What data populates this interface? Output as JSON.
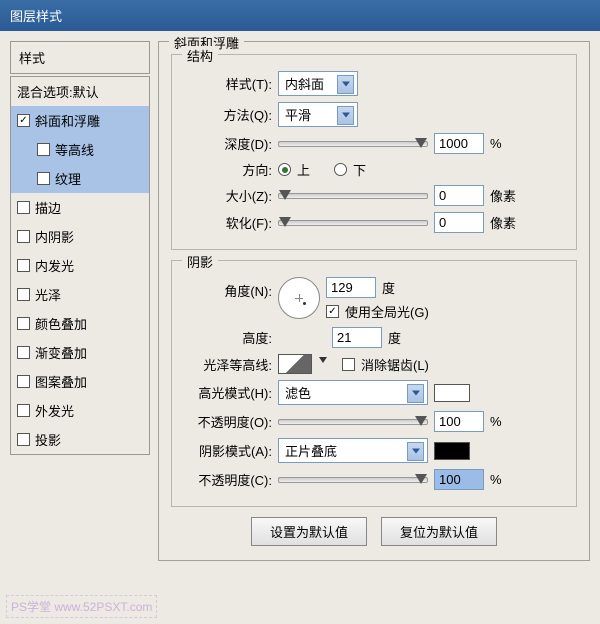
{
  "title": "图层样式",
  "sidebar": {
    "header": "样式",
    "blend": "混合选项:默认",
    "items": [
      {
        "label": "斜面和浮雕",
        "checked": true,
        "selected": true
      },
      {
        "label": "等高线",
        "checked": false,
        "selected": true,
        "indent": true
      },
      {
        "label": "纹理",
        "checked": false,
        "selected": true,
        "indent": true
      },
      {
        "label": "描边",
        "checked": false
      },
      {
        "label": "内阴影",
        "checked": false
      },
      {
        "label": "内发光",
        "checked": false
      },
      {
        "label": "光泽",
        "checked": false
      },
      {
        "label": "颜色叠加",
        "checked": false
      },
      {
        "label": "渐变叠加",
        "checked": false
      },
      {
        "label": "图案叠加",
        "checked": false
      },
      {
        "label": "外发光",
        "checked": false
      },
      {
        "label": "投影",
        "checked": false
      }
    ]
  },
  "main": {
    "legend": "斜面和浮雕",
    "structure": {
      "legend": "结构",
      "style_label": "样式(T):",
      "style_value": "内斜面",
      "technique_label": "方法(Q):",
      "technique_value": "平滑",
      "depth_label": "深度(D):",
      "depth_value": "1000",
      "depth_unit": "%",
      "direction_label": "方向:",
      "up": "上",
      "down": "下",
      "size_label": "大小(Z):",
      "size_value": "0",
      "size_unit": "像素",
      "soften_label": "软化(F):",
      "soften_value": "0",
      "soften_unit": "像素"
    },
    "shading": {
      "legend": "阴影",
      "angle_label": "角度(N):",
      "angle_value": "129",
      "angle_unit": "度",
      "global_light": "使用全局光(G)",
      "altitude_label": "高度:",
      "altitude_value": "21",
      "altitude_unit": "度",
      "gloss_label": "光泽等高线:",
      "antialias": "消除锯齿(L)",
      "highlight_mode_label": "高光模式(H):",
      "highlight_mode_value": "滤色",
      "highlight_opacity_label": "不透明度(O):",
      "highlight_opacity_value": "100",
      "highlight_opacity_unit": "%",
      "shadow_mode_label": "阴影模式(A):",
      "shadow_mode_value": "正片叠底",
      "shadow_opacity_label": "不透明度(C):",
      "shadow_opacity_value": "100",
      "shadow_opacity_unit": "%"
    },
    "buttons": {
      "make_default": "设置为默认值",
      "reset_default": "复位为默认值"
    }
  },
  "watermark": "PS学堂  www.52PSXT.com"
}
